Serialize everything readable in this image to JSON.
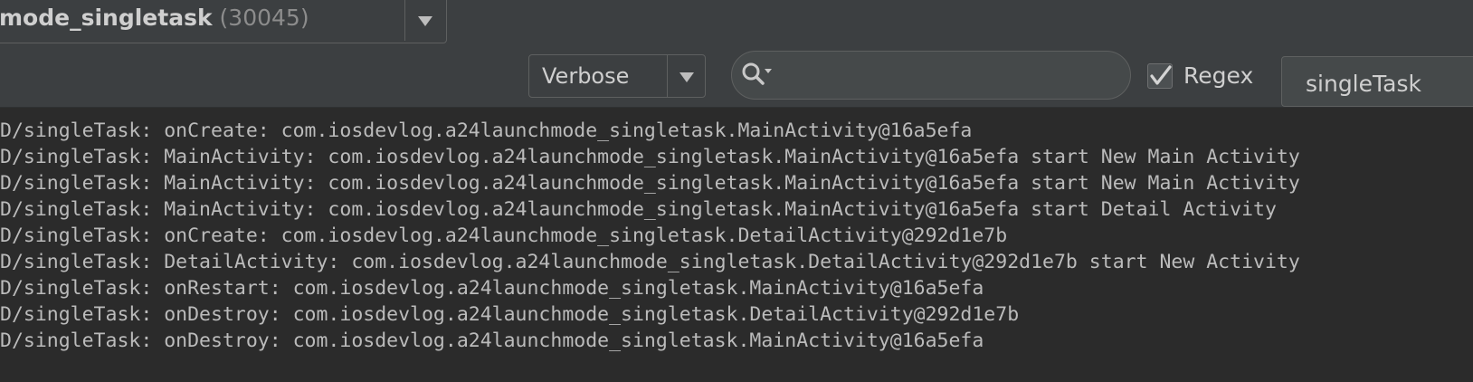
{
  "toolbar": {
    "process_name": "mode_singletask",
    "process_pid": "(30045)",
    "log_level": "Verbose",
    "search": {
      "value": "",
      "placeholder": ""
    },
    "regex_label": "Regex",
    "regex_checked": true,
    "filter_value": "singleTask"
  },
  "logs": [
    "D/singleTask: onCreate: com.iosdevlog.a24launchmode_singletask.MainActivity@16a5efa",
    "D/singleTask: MainActivity: com.iosdevlog.a24launchmode_singletask.MainActivity@16a5efa start New Main Activity",
    "D/singleTask: MainActivity: com.iosdevlog.a24launchmode_singletask.MainActivity@16a5efa start New Main Activity",
    "D/singleTask: MainActivity: com.iosdevlog.a24launchmode_singletask.MainActivity@16a5efa start Detail Activity",
    "D/singleTask: onCreate: com.iosdevlog.a24launchmode_singletask.DetailActivity@292d1e7b",
    "D/singleTask: DetailActivity: com.iosdevlog.a24launchmode_singletask.DetailActivity@292d1e7b start New Activity",
    "D/singleTask: onRestart: com.iosdevlog.a24launchmode_singletask.MainActivity@16a5efa",
    "D/singleTask: onDestroy: com.iosdevlog.a24launchmode_singletask.DetailActivity@292d1e7b",
    "D/singleTask: onDestroy: com.iosdevlog.a24launchmode_singletask.MainActivity@16a5efa"
  ]
}
